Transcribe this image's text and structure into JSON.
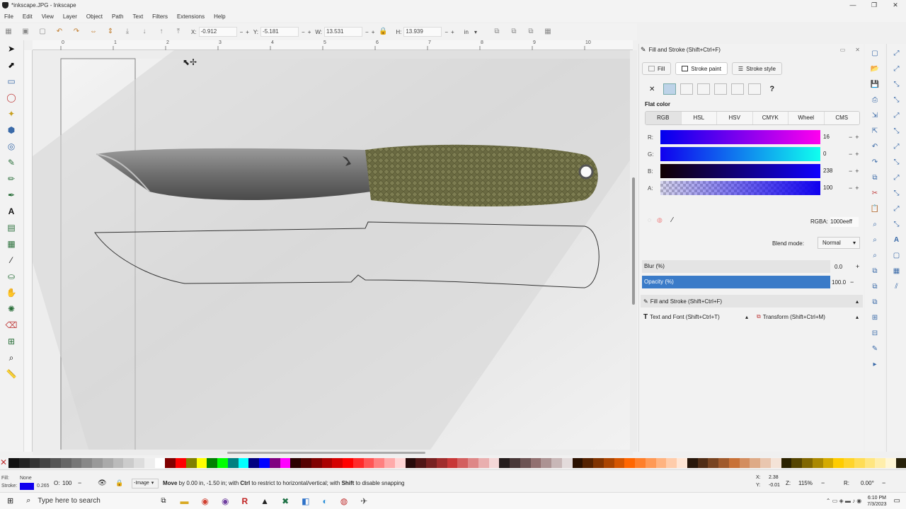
{
  "window": {
    "title": "*inkscape.JPG - Inkscape",
    "controls": [
      "—",
      "❐",
      "✕"
    ]
  },
  "menu": [
    "File",
    "Edit",
    "View",
    "Layer",
    "Object",
    "Path",
    "Text",
    "Filters",
    "Extensions",
    "Help"
  ],
  "toolbar": {
    "x_label": "X:",
    "x_value": "-0.912",
    "y_label": "Y:",
    "y_value": "-5.181",
    "w_label": "W:",
    "w_value": "13.531",
    "h_label": "H:",
    "h_value": "13.939",
    "unit": "in",
    "minus": "−",
    "plus": "+"
  },
  "ruler": {
    "marks": [
      "0",
      "1",
      "2",
      "3",
      "4",
      "5",
      "6",
      "7",
      "8",
      "9",
      "10"
    ]
  },
  "panel": {
    "title": "Fill and Stroke (Shift+Ctrl+F)",
    "tabs": [
      "Fill",
      "Stroke paint",
      "Stroke style"
    ],
    "flat_color_label": "Flat color",
    "color_modes": [
      "RGB",
      "HSL",
      "HSV",
      "CMYK",
      "Wheel",
      "CMS"
    ],
    "channels": [
      {
        "label": "R:",
        "value": "16"
      },
      {
        "label": "G:",
        "value": "0"
      },
      {
        "label": "B:",
        "value": "238"
      },
      {
        "label": "A:",
        "value": "100"
      }
    ],
    "rgba_label": "RGBA:",
    "rgba_value": "1000eeff",
    "blend_label": "Blend mode:",
    "blend_value": "Normal",
    "blur_label": "Blur (%)",
    "blur_value": "0.0",
    "opacity_label": "Opacity (%)",
    "opacity_value": "100.0",
    "collapsed_title": "Fill and Stroke (Shift+Ctrl+F)",
    "text_font_tab": "Text and Font (Shift+Ctrl+T)",
    "transform_tab": "Transform (Shift+Ctrl+M)"
  },
  "status": {
    "fill_label": "Fill:",
    "fill_value": "None",
    "stroke_label": "Stroke:",
    "stroke_value": "0.265",
    "o_label": "O:",
    "o_value": "100",
    "layer": "-Image",
    "message_prefix": "Move",
    "message": " by 0.00 in, -1.50 in; with ",
    "ctrl": "Ctrl",
    "message2": " to restrict to horizontal/vertical; with ",
    "shift": "Shift",
    "message3": " to disable snapping",
    "x_coord_label": "X:",
    "x_coord": "2.38",
    "y_coord_label": "Y:",
    "y_coord": "-0.01",
    "z_label": "Z:",
    "zoom": "115%",
    "r_label": "R:",
    "rotation": "0.00°"
  },
  "taskbar": {
    "search_placeholder": "Type here to search",
    "time": "6:10 PM",
    "date": "7/3/2023"
  },
  "colors": {
    "stroke_blue": "#1000ee",
    "accent": "#3a7bc8"
  },
  "palette": [
    "#111111",
    "#222222",
    "#333333",
    "#444444",
    "#555555",
    "#666666",
    "#777777",
    "#888888",
    "#999999",
    "#aaaaaa",
    "#bbbbbb",
    "#cccccc",
    "#dddddd",
    "#eeeeee",
    "#ffffff",
    "#800000",
    "#ff0000",
    "#808000",
    "#ffff00",
    "#008000",
    "#00ff00",
    "#008080",
    "#00ffff",
    "#000080",
    "#0000ff",
    "#800080",
    "#ff00ff",
    "#2b0000",
    "#550000",
    "#800000",
    "#aa0000",
    "#d40000",
    "#ff0000",
    "#ff2a2a",
    "#ff5555",
    "#ff8080",
    "#ffaaaa",
    "#ffd5d5",
    "#280b0b",
    "#501616",
    "#782121",
    "#a02c2c",
    "#c83737",
    "#d35f5f",
    "#de8787",
    "#e9afaf",
    "#f4d7d7",
    "#241c1c",
    "#483737",
    "#6c5353",
    "#916f6f",
    "#ac9393",
    "#c8b7b7",
    "#e3dbdb",
    "#2b1100",
    "#552200",
    "#803300",
    "#aa4400",
    "#d45500",
    "#ff6600",
    "#ff7f2a",
    "#ff9955",
    "#ffb380",
    "#ffccaa",
    "#ffe6d5",
    "#28170b",
    "#502d16",
    "#784421",
    "#a05a2c",
    "#c87137",
    "#d38d5f",
    "#deaa87",
    "#e9c6af",
    "#f4e3d7",
    "#2b2200",
    "#554400",
    "#806600",
    "#aa8800",
    "#d4aa00",
    "#ffcc00",
    "#ffd42a",
    "#ffdd55",
    "#ffe680",
    "#ffeeaa",
    "#fff6d5",
    "#28220b"
  ]
}
